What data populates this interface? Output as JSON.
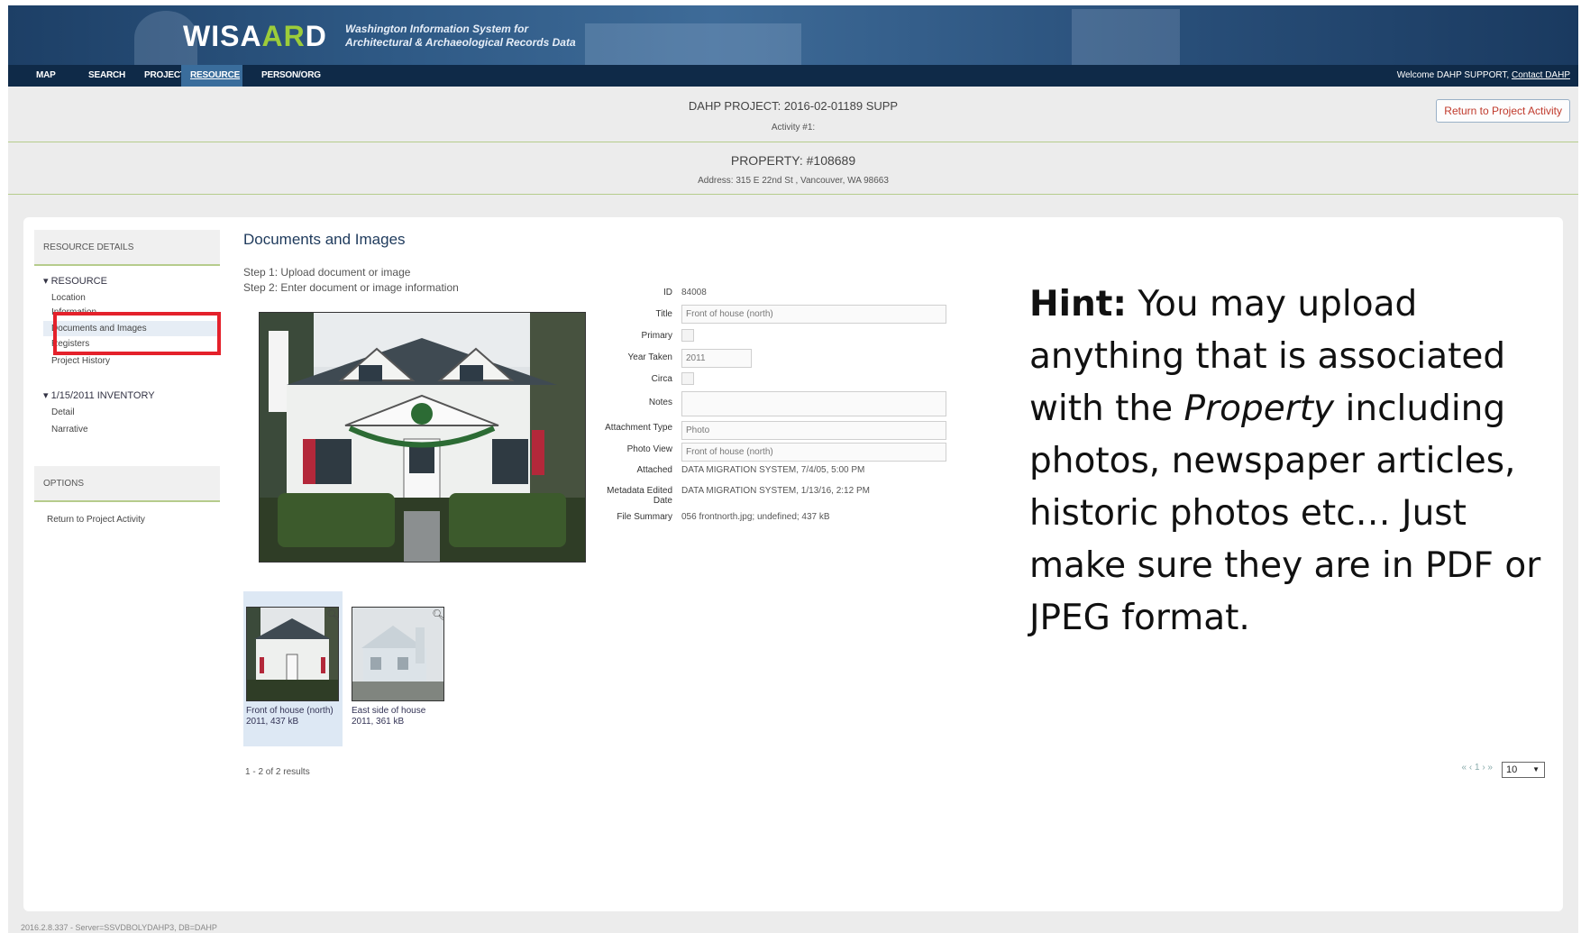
{
  "app": {
    "logo": "WISA",
    "logo_green": "AR",
    "logo_end": "D",
    "subtitle_line1": "Washington Information System for",
    "subtitle_line2": "Architectural & Archaeological Records Data"
  },
  "nav": {
    "items": [
      "MAP",
      "SEARCH",
      "PROJECT",
      "RESOURCE",
      "PERSON/ORG"
    ],
    "active": "RESOURCE",
    "welcome": "Welcome DAHP SUPPORT,",
    "contact": "Contact DAHP"
  },
  "project": {
    "title": "DAHP PROJECT: 2016-02-01189 SUPP",
    "activity": "Activity #1:",
    "return_button": "Return to Project Activity"
  },
  "property": {
    "title": "PROPERTY: #108689",
    "address": "Address: 315 E 22nd St , Vancouver, WA 98663"
  },
  "sidebar": {
    "resource_details": "RESOURCE DETAILS",
    "group1": "RESOURCE",
    "group1_items": [
      "Location",
      "Information",
      "Documents and Images",
      "Registers",
      "Project History"
    ],
    "selected": "Documents and Images",
    "group2": "1/15/2011 INVENTORY",
    "group2_items": [
      "Detail",
      "Narrative"
    ],
    "options": "OPTIONS",
    "return_link": "Return to Project Activity"
  },
  "main": {
    "title": "Documents and Images",
    "step1": "Step 1: Upload document or image",
    "step2": "Step 2: Enter document or image information"
  },
  "form": {
    "id_label": "ID",
    "id_value": "84008",
    "title_label": "Title",
    "title_value": "Front of house (north)",
    "primary_label": "Primary",
    "year_label": "Year Taken",
    "year_value": "2011",
    "circa_label": "Circa",
    "notes_label": "Notes",
    "notes_value": "",
    "attachment_type_label": "Attachment Type",
    "attachment_type_value": "Photo",
    "photo_view_label": "Photo View",
    "photo_view_value": "Front of house (north)",
    "attached_label": "Attached",
    "attached_value": "DATA MIGRATION SYSTEM, 7/4/05, 5:00 PM",
    "metadata_label_1": "Metadata Edited",
    "metadata_label_2": "Date",
    "metadata_value": "DATA MIGRATION SYSTEM, 1/13/16, 2:12 PM",
    "file_summary_label": "File Summary",
    "file_summary_value": "056 frontnorth.jpg; undefined; 437 kB"
  },
  "thumbnails": [
    {
      "caption": "Front of house (north)",
      "meta": "2011, 437 kB"
    },
    {
      "caption": "East side of house",
      "meta": "2011, 361 kB"
    }
  ],
  "pagination": {
    "results": "1 - 2 of 2 results",
    "nav": "« ‹ 1 › »",
    "page_size": "10"
  },
  "hint": {
    "label": "Hint:",
    "text_1": " You may upload anything that is associated with the ",
    "emphasis": "Property",
    "text_2": " including photos, newspaper articles, historic photos etc… Just make sure they are in PDF or JPEG format."
  },
  "footer": "2016.2.8.337 - Server=SSVDBOLYDAHP3, DB=DAHP",
  "colors": {
    "nav_bg": "#0f2a48",
    "active_tab": "#3a6d9c",
    "accent_green": "#b6cc8c",
    "highlight_red": "#e4212b",
    "return_text": "#c0392b"
  }
}
